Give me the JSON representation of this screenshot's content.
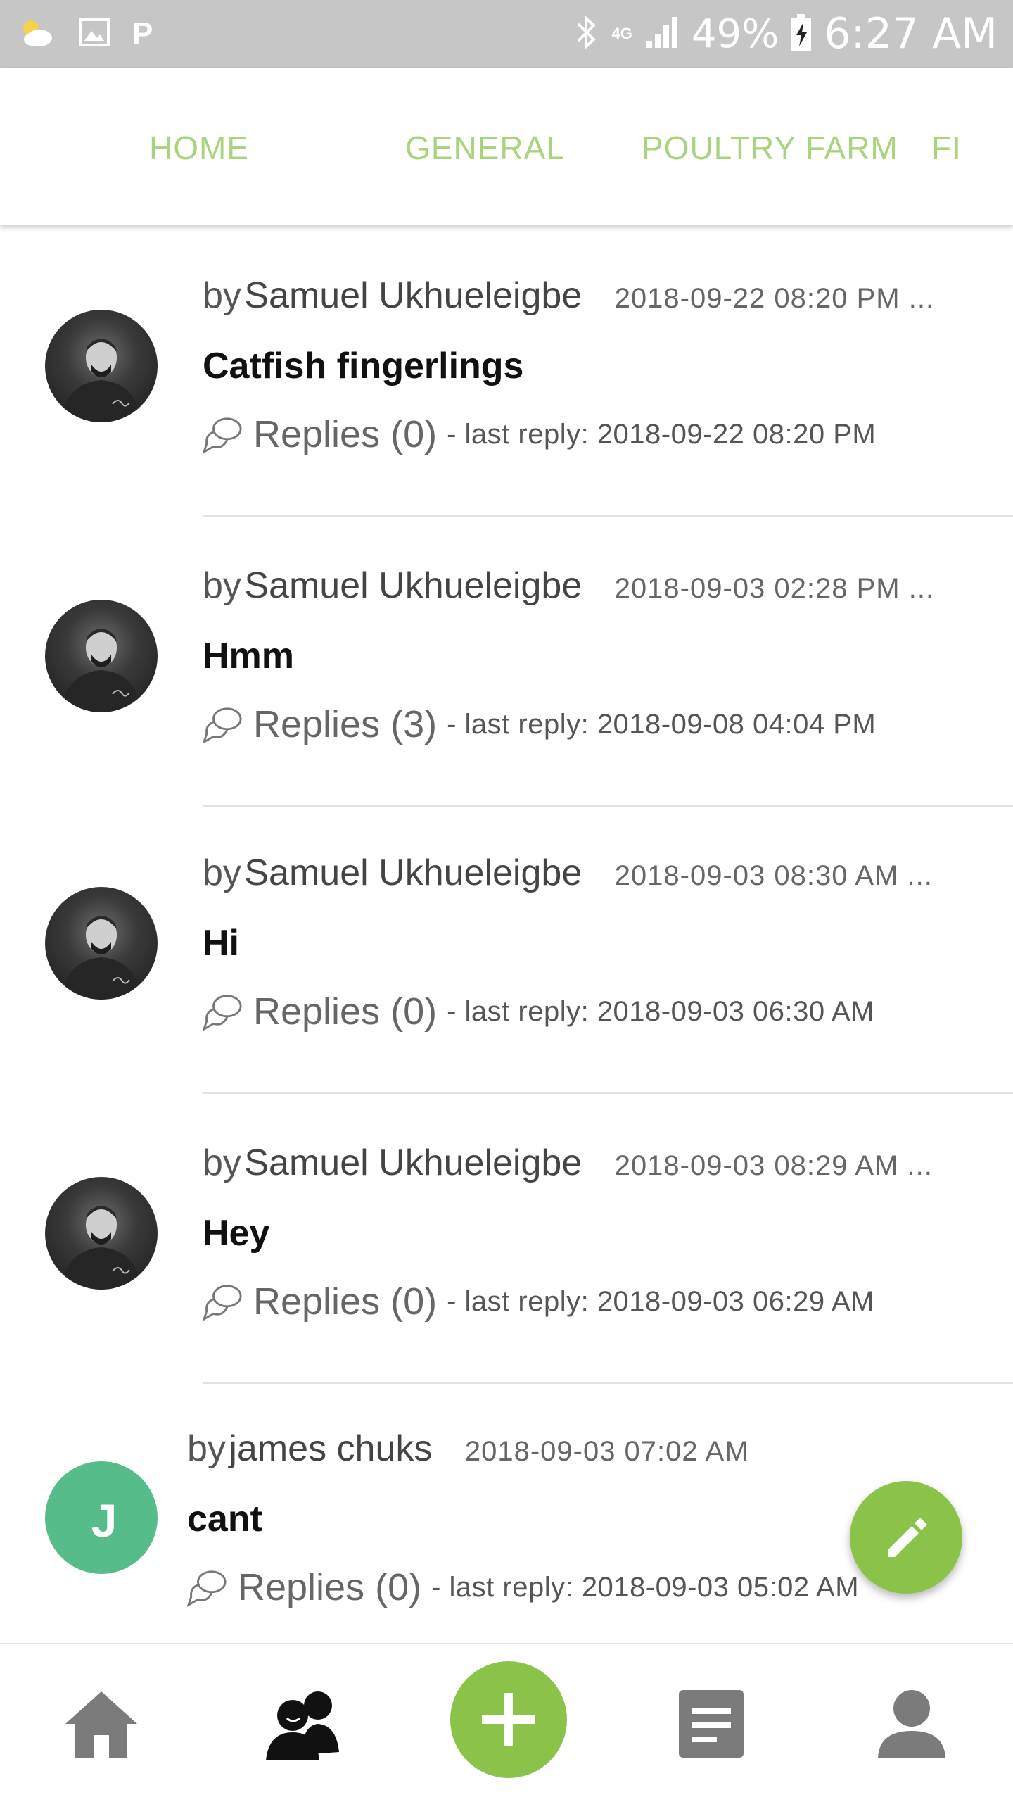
{
  "status_bar": {
    "p_indicator": "P",
    "network": "4G",
    "battery": "49%",
    "time": "6:27 AM",
    "icons": [
      "weather-icon",
      "image-icon",
      "bluetooth-icon",
      "signal-icon",
      "battery-charging-icon"
    ]
  },
  "tabs": [
    {
      "label": "HOME"
    },
    {
      "label": "GENERAL"
    },
    {
      "label": "POULTRY FARM"
    },
    {
      "label": "FI"
    }
  ],
  "posts": [
    {
      "by": "by",
      "author": "Samuel Ukhueleigbe",
      "date": "2018-09-22 08:20 PM ...",
      "title": "Catfish fingerlings",
      "replies": "Replies (0)",
      "last_reply": "- last reply: 2018-09-22 08:20 PM",
      "avatar": "photo"
    },
    {
      "by": "by",
      "author": "Samuel Ukhueleigbe",
      "date": "2018-09-03 02:28 PM ...",
      "title": "Hmm",
      "replies": "Replies (3)",
      "last_reply": "- last reply: 2018-09-08 04:04 PM",
      "avatar": "photo"
    },
    {
      "by": "by",
      "author": "Samuel Ukhueleigbe",
      "date": "2018-09-03 08:30 AM ...",
      "title": "Hi",
      "replies": "Replies (0)",
      "last_reply": "- last reply: 2018-09-03 06:30 AM",
      "avatar": "photo"
    },
    {
      "by": "by",
      "author": "Samuel Ukhueleigbe",
      "date": "2018-09-03 08:29 AM ...",
      "title": "Hey",
      "replies": "Replies (0)",
      "last_reply": "- last reply: 2018-09-03 06:29 AM",
      "avatar": "photo"
    },
    {
      "by": "by",
      "author": "james chuks",
      "date": "2018-09-03 07:02 AM",
      "title": "cant",
      "replies": "Replies (0)",
      "last_reply": "- last reply: 2018-09-03 05:02 AM",
      "avatar": "J"
    }
  ],
  "fab": {
    "icon": "pencil-icon"
  },
  "bottom_nav": {
    "items": [
      "home-icon",
      "community-icon",
      "plus-icon",
      "document-icon",
      "profile-icon"
    ],
    "active": "community-icon"
  },
  "colors": {
    "accent_green": "#8bc34a",
    "tab_text": "#a8d47e",
    "avatar_green": "#56bc8a",
    "status_bar": "#c6c6c6"
  }
}
